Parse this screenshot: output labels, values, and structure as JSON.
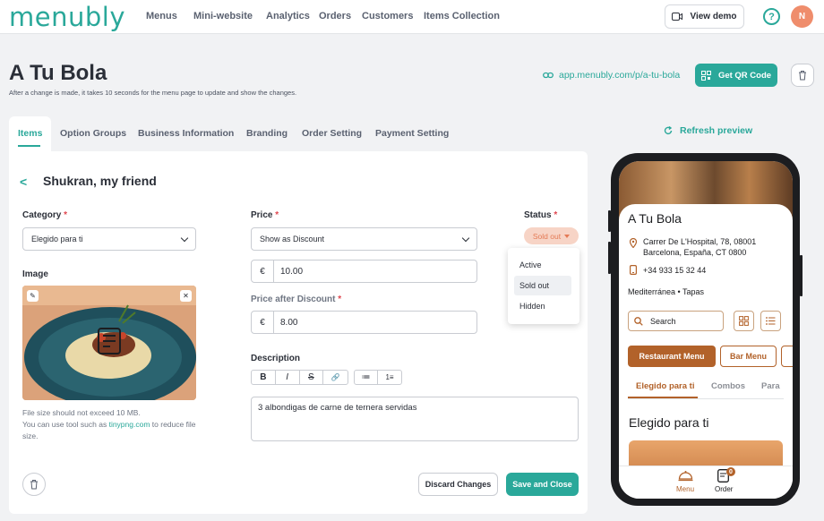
{
  "brand": {
    "logo": "menubly",
    "accent": "#2aa89a",
    "menu_accent": "#b2622a"
  },
  "nav": {
    "items": [
      "Menus",
      "Mini-website",
      "Analytics",
      "Orders",
      "Customers",
      "Items Collection"
    ],
    "view_demo": "View demo",
    "help": "?",
    "avatar": "N"
  },
  "page": {
    "title": "A Tu Bola",
    "note": "After a change is made, it takes 10 seconds for the menu page to update and show the changes.",
    "link": "app.menubly.com/p/a-tu-bola",
    "qr_button": "Get QR Code"
  },
  "tabs": [
    "Items",
    "Option Groups",
    "Business Information",
    "Branding",
    "Order Setting",
    "Payment Setting"
  ],
  "refresh": "Refresh preview",
  "item": {
    "back": "<",
    "title": "Shukran, my friend",
    "category_label": "Category",
    "category_value": "Elegido para ti",
    "price_label": "Price",
    "price_mode": "Show as Discount",
    "currency": "€",
    "price": "10.00",
    "discount_label": "Price after Discount",
    "discount_price": "8.00",
    "status_label": "Status",
    "status_value": "Sold out",
    "status_options": [
      "Active",
      "Sold out",
      "Hidden"
    ],
    "required_mark": "*",
    "image_label": "Image",
    "hint_1": "File size should not exceed 10 MB.",
    "hint_2": "You can use tool such as",
    "hint_link": "tinypng.com",
    "hint_3": "to reduce file size.",
    "description_label": "Description",
    "description": "3 albondigas de carne de ternera servidas",
    "toolbar": [
      "B",
      "I",
      "S",
      "🔗",
      "≔",
      "1≡"
    ],
    "discard": "Discard Changes",
    "save": "Save and Close"
  },
  "preview": {
    "title": "A Tu Bola",
    "address_1": "Carrer De L'Hospital, 78, 08001",
    "address_2": "Barcelona, España, CT 0800",
    "phone": "+34 933 15 32 44",
    "cuisine": "Mediterránea • Tapas",
    "search": "Search",
    "menu_buttons": [
      "Restaurant Menu",
      "Bar Menu"
    ],
    "categories": [
      "Elegido para ti",
      "Combos",
      "Para"
    ],
    "section": "Elegido para ti",
    "bottom_nav": [
      "Menu",
      "Order"
    ],
    "order_count": "0"
  }
}
